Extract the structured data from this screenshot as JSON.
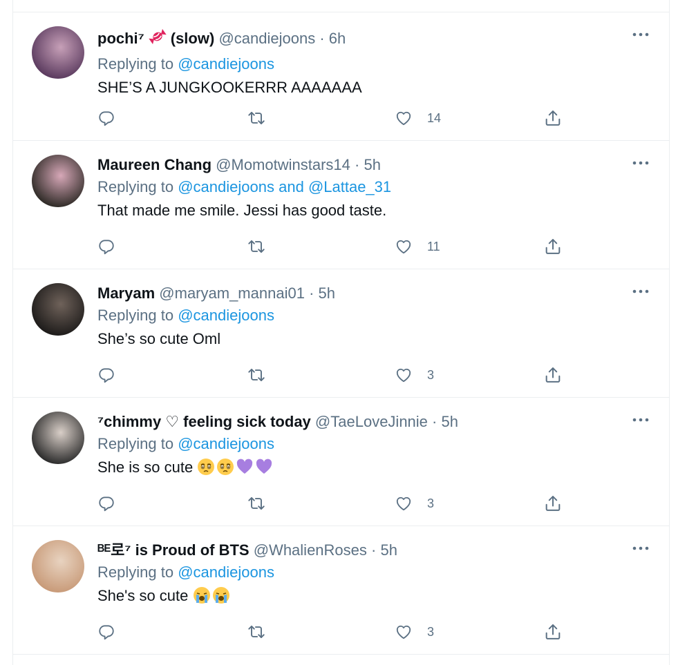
{
  "colors": {
    "text": "#0f1419",
    "secondary": "#5b7083",
    "link": "#1b95e0",
    "border": "#ebeef0",
    "heart_emoji": "#a77ee0"
  },
  "tweets": [
    {
      "display_name": "pochi⁷",
      "name_suffix": "(slow)",
      "badge_icon": "candy-icon",
      "handle": "@candiejoons",
      "separator": "·",
      "time": "6h",
      "replying_prefix": "Replying to",
      "reply_to": "@candiejoons",
      "reply_to_second": "",
      "reply_joiner": "",
      "text": "SHE’S A JUNGKOOKERRR AAAAAAA",
      "emojis": [],
      "like_count": "14",
      "avatar_colors": [
        "#5a3a5e",
        "#c7a0b8"
      ]
    },
    {
      "display_name": "Maureen Chang",
      "name_suffix": "",
      "badge_icon": "",
      "handle": "@Momotwinstars14",
      "separator": "·",
      "time": "5h",
      "replying_prefix": "Replying to",
      "reply_to": "@candiejoons",
      "reply_joiner": "and",
      "reply_to_second": "@Lattae_31",
      "text": "That made me smile. Jessi has good taste.",
      "emojis": [],
      "like_count": "11",
      "avatar_colors": [
        "#2e2a26",
        "#d7a8b8"
      ]
    },
    {
      "display_name": "Maryam",
      "name_suffix": "",
      "badge_icon": "",
      "handle": "@maryam_mannai01",
      "separator": "·",
      "time": "5h",
      "replying_prefix": "Replying to",
      "reply_to": "@candiejoons",
      "reply_to_second": "",
      "reply_joiner": "",
      "text": "She’s so cute Oml",
      "emojis": [],
      "like_count": "3",
      "avatar_colors": [
        "#1d1b1a",
        "#6f625a"
      ]
    },
    {
      "display_name": "⁷chimmy ♡ feeling sick today",
      "name_suffix": "",
      "badge_icon": "",
      "handle": "@TaeLoveJinnie",
      "separator": "·",
      "time": "5h",
      "replying_prefix": "Replying to",
      "reply_to": "@candiejoons",
      "reply_to_second": "",
      "reply_joiner": "",
      "text": "She is so cute",
      "emojis": [
        "face-holding-back-tears-emoji",
        "face-holding-back-tears-emoji",
        "purple-heart-emoji",
        "purple-heart-emoji"
      ],
      "like_count": "3",
      "avatar_colors": [
        "#2b2b2b",
        "#d9cfc8"
      ]
    },
    {
      "display_name": "ᴮᴱ로⁷ is Proud of BTS",
      "name_suffix": "",
      "badge_icon": "",
      "handle": "@WhalienRoses",
      "separator": "·",
      "time": "5h",
      "replying_prefix": "Replying to",
      "reply_to": "@candiejoons",
      "reply_to_second": "",
      "reply_joiner": "",
      "text": "She's so cute",
      "emojis": [
        "loudly-crying-face-emoji",
        "loudly-crying-face-emoji"
      ],
      "like_count": "3",
      "avatar_colors": [
        "#c89a78",
        "#e8d3c0"
      ]
    }
  ]
}
